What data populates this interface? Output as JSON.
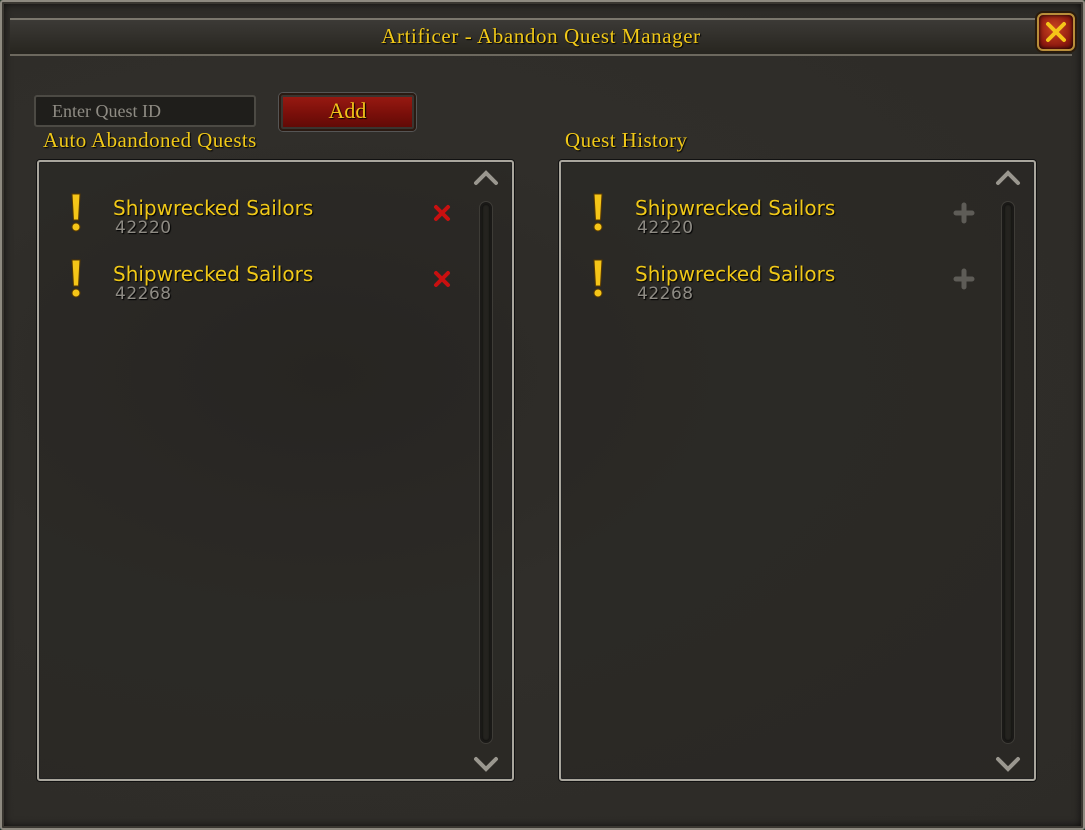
{
  "window": {
    "title": "Artificer - Abandon Quest Manager",
    "close_icon": "close-x-icon"
  },
  "controls": {
    "quest_id_placeholder": "Enter Quest ID",
    "add_label": "Add"
  },
  "auto_abandoned": {
    "label": "Auto Abandoned Quests",
    "row_action_icon": "remove-x-icon",
    "items": [
      {
        "name": "Shipwrecked Sailors",
        "id": "42220"
      },
      {
        "name": "Shipwrecked Sailors",
        "id": "42268"
      }
    ]
  },
  "quest_history": {
    "label": "Quest History",
    "row_action_icon": "add-plus-icon",
    "items": [
      {
        "name": "Shipwrecked Sailors",
        "id": "42220"
      },
      {
        "name": "Shipwrecked Sailors",
        "id": "42268"
      }
    ]
  },
  "colors": {
    "gold_text": "#f0c818",
    "quest_id_text": "#8e8b84",
    "button_red": "#8a1510",
    "frame_bg": "#2d2b27"
  }
}
